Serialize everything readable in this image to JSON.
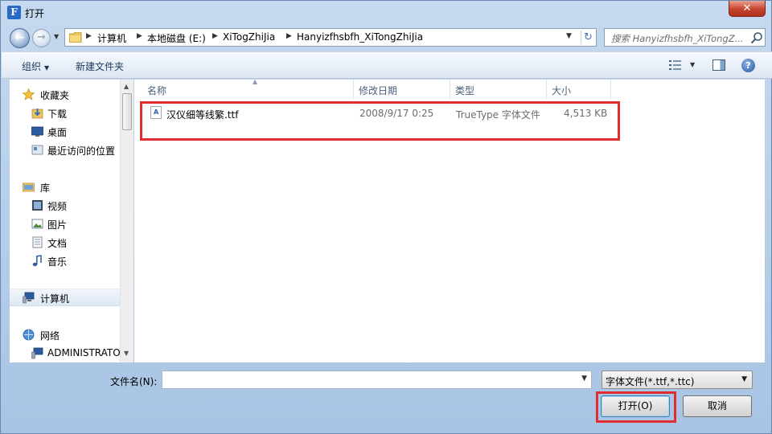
{
  "window": {
    "title": "打开",
    "app_icon_letter": "F",
    "close_glyph": "✕"
  },
  "address": {
    "crumbs": [
      "计算机",
      "本地磁盘 (E:)",
      "XiTogZhiJia",
      "Hanyizfhsbfh_XiTongZhiJia"
    ],
    "search_placeholder": "搜索 Hanyizfhsbfh_XiTongZ..."
  },
  "toolbar": {
    "organize_label": "组织",
    "new_folder_label": "新建文件夹",
    "help_glyph": "?"
  },
  "nav": {
    "favorites_label": "收藏夹",
    "downloads_label": "下载",
    "desktop_label": "桌面",
    "recent_label": "最近访问的位置",
    "libraries_label": "库",
    "videos_label": "视频",
    "pictures_label": "图片",
    "documents_label": "文档",
    "music_label": "音乐",
    "computer_label": "计算机",
    "network_label": "网络",
    "admin_label": "ADMINISTRATO"
  },
  "columns": {
    "name": "名称",
    "modified": "修改日期",
    "type": "类型",
    "size": "大小"
  },
  "files": [
    {
      "name": "汉仪细等线繁.ttf",
      "modified": "2008/9/17 0:25",
      "type": "TrueType 字体文件",
      "size": "4,513 KB"
    }
  ],
  "bottom": {
    "filename_label": "文件名(N):",
    "filename_value": "",
    "filter_value": "字体文件(*.ttf,*.ttc)",
    "open_label": "打开(O)",
    "cancel_label": "取消"
  },
  "colors": {
    "highlight": "#e02d2d",
    "accent": "#3c7fb1"
  }
}
